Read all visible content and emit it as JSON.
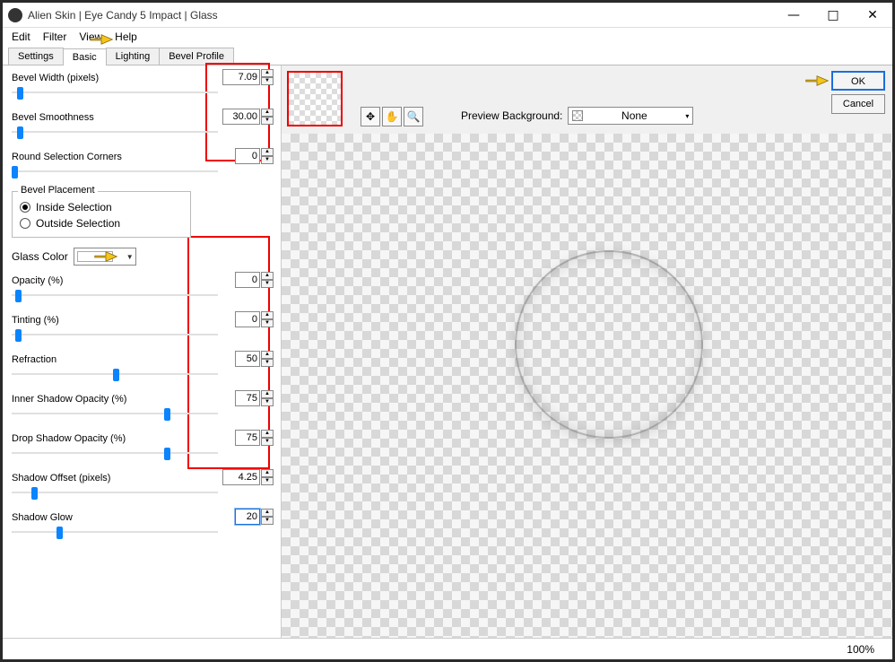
{
  "window": {
    "title": "Alien Skin | Eye Candy 5 Impact | Glass",
    "min": "—",
    "max": "□",
    "close": "✕"
  },
  "menu": {
    "edit": "Edit",
    "filter": "Filter",
    "view": "View",
    "help": "Help"
  },
  "tabs": {
    "settings": "Settings",
    "basic": "Basic",
    "lighting": "Lighting",
    "bevel_profile": "Bevel Profile"
  },
  "params": {
    "bevel_width": {
      "label": "Bevel Width (pixels)",
      "value": "7.09",
      "thumb_pct": 3
    },
    "bevel_smoothness": {
      "label": "Bevel Smoothness",
      "value": "30.00",
      "thumb_pct": 3
    },
    "round_corners": {
      "label": "Round Selection Corners",
      "value": "0",
      "thumb_pct": 0
    },
    "opacity": {
      "label": "Opacity (%)",
      "value": "0",
      "thumb_pct": 2
    },
    "tinting": {
      "label": "Tinting (%)",
      "value": "0",
      "thumb_pct": 2
    },
    "refraction": {
      "label": "Refraction",
      "value": "50",
      "thumb_pct": 50
    },
    "inner_shadow": {
      "label": "Inner Shadow Opacity (%)",
      "value": "75",
      "thumb_pct": 74
    },
    "drop_shadow": {
      "label": "Drop Shadow Opacity (%)",
      "value": "75",
      "thumb_pct": 74
    },
    "shadow_offset": {
      "label": "Shadow Offset (pixels)",
      "value": "4.25",
      "thumb_pct": 10
    },
    "shadow_glow": {
      "label": "Shadow Glow",
      "value": "20",
      "thumb_pct": 22
    }
  },
  "placement": {
    "title": "Bevel Placement",
    "inside": "Inside Selection",
    "outside": "Outside Selection"
  },
  "glass_color_label": "Glass Color",
  "preview": {
    "bg_label": "Preview Background:",
    "bg_value": "None"
  },
  "buttons": {
    "ok": "OK",
    "cancel": "Cancel"
  },
  "status": {
    "zoom": "100%"
  }
}
